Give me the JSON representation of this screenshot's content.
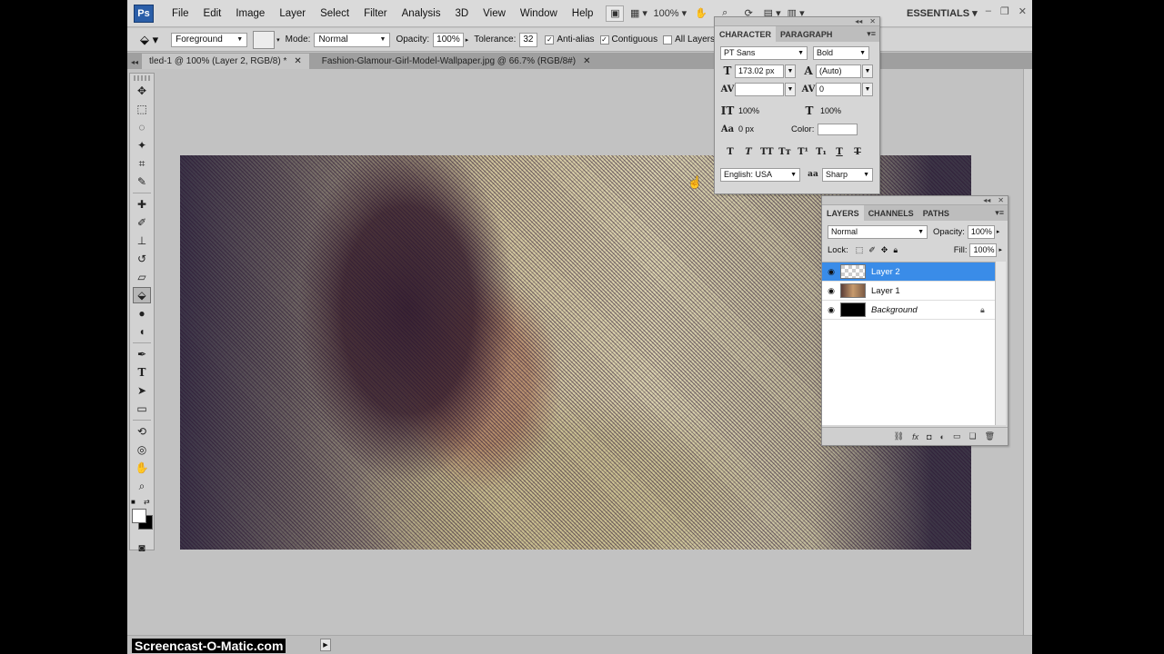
{
  "app": {
    "logo": "Ps",
    "workspace": "ESSENTIALS",
    "zoom_level": "100%"
  },
  "menu": [
    "File",
    "Edit",
    "Image",
    "Layer",
    "Select",
    "Filter",
    "Analysis",
    "3D",
    "View",
    "Window",
    "Help"
  ],
  "options": {
    "source": "Foreground",
    "mode_label": "Mode:",
    "mode": "Normal",
    "opacity_label": "Opacity:",
    "opacity": "100%",
    "tolerance_label": "Tolerance:",
    "tolerance": "32",
    "antialias": "Anti-alias",
    "contiguous": "Contiguous",
    "all_layers": "All Layers"
  },
  "tabs": [
    {
      "label": "tled-1 @ 100% (Layer 2, RGB/8) *",
      "active": true
    },
    {
      "label": "Fashion-Glamour-Girl-Model-Wallpaper.jpg @ 66.7% (RGB/8#)",
      "active": false
    }
  ],
  "character": {
    "tabs": [
      "CHARACTER",
      "PARAGRAPH"
    ],
    "font_family": "PT Sans",
    "font_style": "Bold",
    "size": "173.02 px",
    "leading": "(Auto)",
    "kerning": "",
    "tracking": "0",
    "vscale": "100%",
    "hscale": "100%",
    "baseline": "0 px",
    "color_label": "Color:",
    "language": "English: USA",
    "antialias": "Sharp"
  },
  "layers": {
    "tabs": [
      "LAYERS",
      "CHANNELS",
      "PATHS"
    ],
    "blend_mode": "Normal",
    "opacity_label": "Opacity:",
    "opacity": "100%",
    "lock_label": "Lock:",
    "fill_label": "Fill:",
    "fill": "100%",
    "items": [
      {
        "name": "Layer 2",
        "selected": true
      },
      {
        "name": "Layer 1",
        "selected": false
      },
      {
        "name": "Background",
        "selected": false
      }
    ]
  },
  "watermark": "Screencast-O-Matic.com",
  "colors": {
    "foreground": "#ffffff",
    "background": "#000000",
    "selection": "#3a8ce8"
  }
}
